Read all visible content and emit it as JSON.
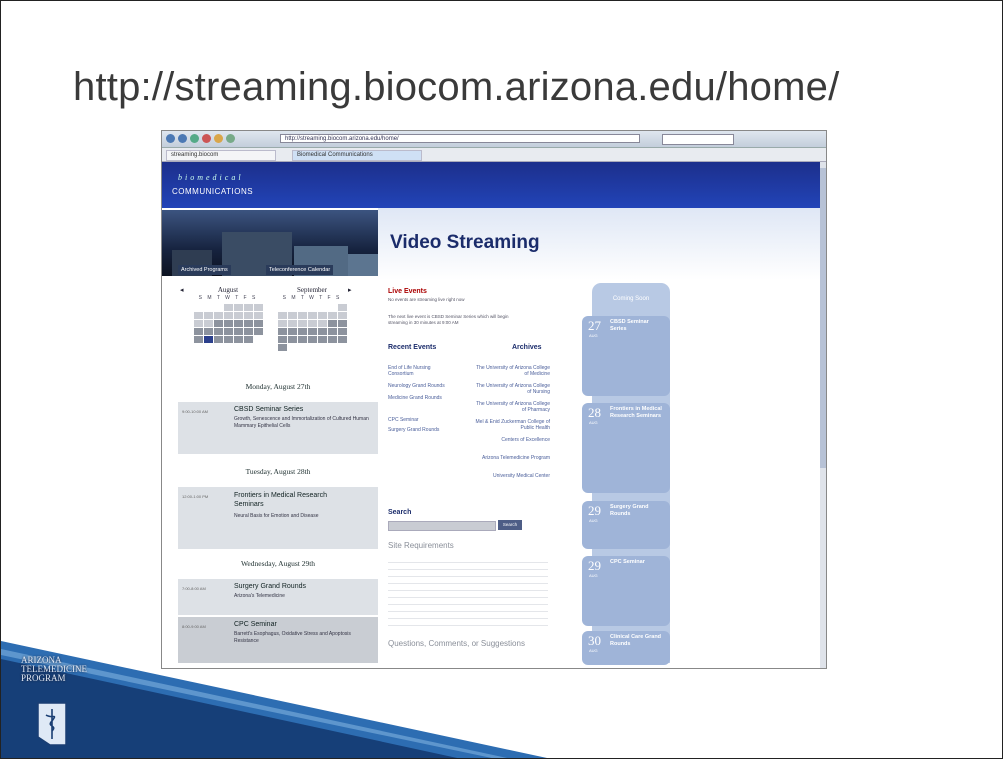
{
  "slide": {
    "title": "http://streaming.biocom.arizona.edu/home/"
  },
  "browser": {
    "address": "http://streaming.biocom.arizona.edu/home/",
    "tabs": [
      "streaming.biocom",
      "Biomedical Communications"
    ]
  },
  "site": {
    "logo_top": "biomedical",
    "logo_bottom": "COMMUNICATIONS",
    "banner_title": "Video Streaming",
    "photo_tabs": [
      "Archived Programs",
      "Teleconference Calendar"
    ]
  },
  "calendar": {
    "months": [
      "August",
      "September"
    ],
    "dow": "S M T W T F S"
  },
  "schedule": [
    {
      "day": "Monday, August 27th",
      "events": [
        {
          "title": "CBSD Seminar Series",
          "desc": "Growth, Senescence and Immortalization of Cultured Human Mammary Epithelial Cells"
        }
      ]
    },
    {
      "day": "Tuesday, August 28th",
      "events": [
        {
          "title": "Frontiers in Medical Research Seminars",
          "desc": "Neural Basis for Emotion and Disease"
        }
      ]
    },
    {
      "day": "Wednesday, August 29th",
      "events": [
        {
          "title": "Surgery Grand Rounds",
          "desc": "Arizona's Telemedicine"
        },
        {
          "title": "CPC Seminar",
          "desc": "Barrett's Esophagus, Oxidative Stress and Apoptosis Resistance"
        }
      ]
    }
  ],
  "middle": {
    "live_events": "Live Events",
    "live_note": "No events are streaming live right now",
    "next_note": "The next live event is CBSD Seminar Series which will begin streaming in 30 minutes at 9:00 AM",
    "recent_events": "Recent Events",
    "archives": "Archives",
    "recent_links": [
      "End of Life Nursing Consortium",
      "Neurology Grand Rounds",
      "Medicine Grand Rounds",
      "CPC Seminar",
      "Surgery Grand Rounds"
    ],
    "archive_links": [
      "The University of Arizona College of Medicine",
      "The University of Arizona College of Nursing",
      "The University of Arizona College of Pharmacy",
      "Mel & Enid Zuckerman College of Public Health",
      "Centers of Excellence",
      "Arizona Telemedicine Program",
      "University Medical Center"
    ],
    "search": "Search",
    "search_btn": "Search",
    "site_req": "Site Requirements",
    "questions": "Questions, Comments, or Suggestions"
  },
  "coming_soon": {
    "title": "Coming Soon",
    "items": [
      {
        "day": "27",
        "mon": "AUG",
        "name": "CBSD Seminar Series"
      },
      {
        "day": "28",
        "mon": "AUG",
        "name": "Frontiers in Medical Research Seminars"
      },
      {
        "day": "29",
        "mon": "AUG",
        "name": "Surgery Grand Rounds"
      },
      {
        "day": "29",
        "mon": "AUG",
        "name": "CPC Seminar"
      },
      {
        "day": "30",
        "mon": "AUG",
        "name": "Clinical Care Grand Rounds"
      }
    ]
  },
  "program_logo": {
    "lines": [
      "ARIZONA",
      "TELEMEDICINE",
      "PROGRAM"
    ]
  },
  "colors": {
    "header_blue": "#2244b8",
    "banner_navy": "#1b2c6b",
    "coming_soon": "#9fb4d8",
    "ribbon": "#1f5a9a"
  }
}
